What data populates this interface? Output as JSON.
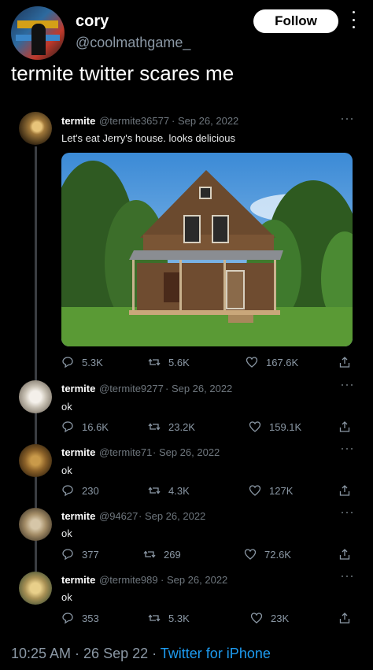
{
  "header": {
    "name": "cory",
    "handle": "@coolmathgame_",
    "follow_label": "Follow"
  },
  "main_tweet_text": "termite twitter scares me",
  "quoted_tweets": [
    {
      "name": "termite",
      "handle": "@termite36577",
      "date": "· Sep 26, 2022",
      "text": "Let's eat Jerry's house. looks delicious",
      "replies": "5.3K",
      "retweets": "5.6K",
      "likes": "167.6K"
    },
    {
      "name": "termite",
      "handle": "@termite9277",
      "date": "· Sep 26, 2022",
      "text": "ok",
      "replies": "16.6K",
      "retweets": "23.2K",
      "likes": "159.1K"
    },
    {
      "name": "termite",
      "handle": "@termite71",
      "date": "· Sep 26, 2022",
      "text": "ok",
      "replies": "230",
      "retweets": "4.3K",
      "likes": "127K"
    },
    {
      "name": "termite",
      "handle": "@94627",
      "date": "· Sep 26, 2022",
      "text": "ok",
      "replies": "377",
      "retweets": "269",
      "likes": "72.6K"
    },
    {
      "name": "termite",
      "handle": "@termite989",
      "date": "· Sep 26, 2022",
      "text": "ok",
      "replies": "353",
      "retweets": "5.3K",
      "likes": "23K"
    }
  ],
  "footer": {
    "time_date": "10:25 AM · 26 Sep 22 · ",
    "client": "Twitter for iPhone"
  },
  "colors": {
    "background": "#000000",
    "accent": "#1d9bf0",
    "muted": "#8b98a5"
  }
}
